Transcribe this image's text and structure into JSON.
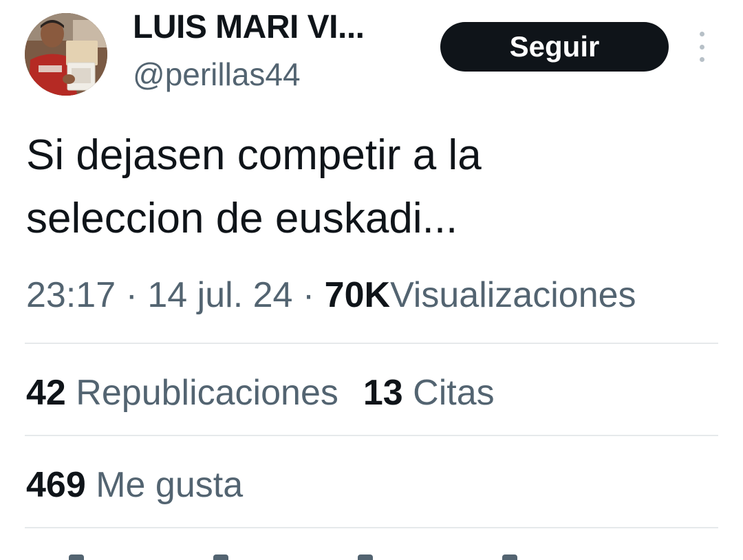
{
  "author": {
    "display_name": "LUIS MARI VI...",
    "handle": "@perillas44"
  },
  "follow_button": {
    "label": "Seguir"
  },
  "tweet": {
    "text": "Si dejasen competir a la\nseleccion de euskadi..."
  },
  "meta": {
    "time": "23:17",
    "separator": "·",
    "date": "14 jul. 24",
    "views_count": "70K",
    "views_label": "Visualizaciones"
  },
  "stats": {
    "reposts_count": "42",
    "reposts_label": "Republicaciones",
    "quotes_count": "13",
    "quotes_label": "Citas",
    "likes_count": "469",
    "likes_label": "Me gusta"
  },
  "colors": {
    "text_primary": "#0f1419",
    "text_secondary": "#536471",
    "button_bg": "#0f1419",
    "divider": "#e6e9eb"
  },
  "icons": {
    "more": "more-vertical-icon"
  }
}
